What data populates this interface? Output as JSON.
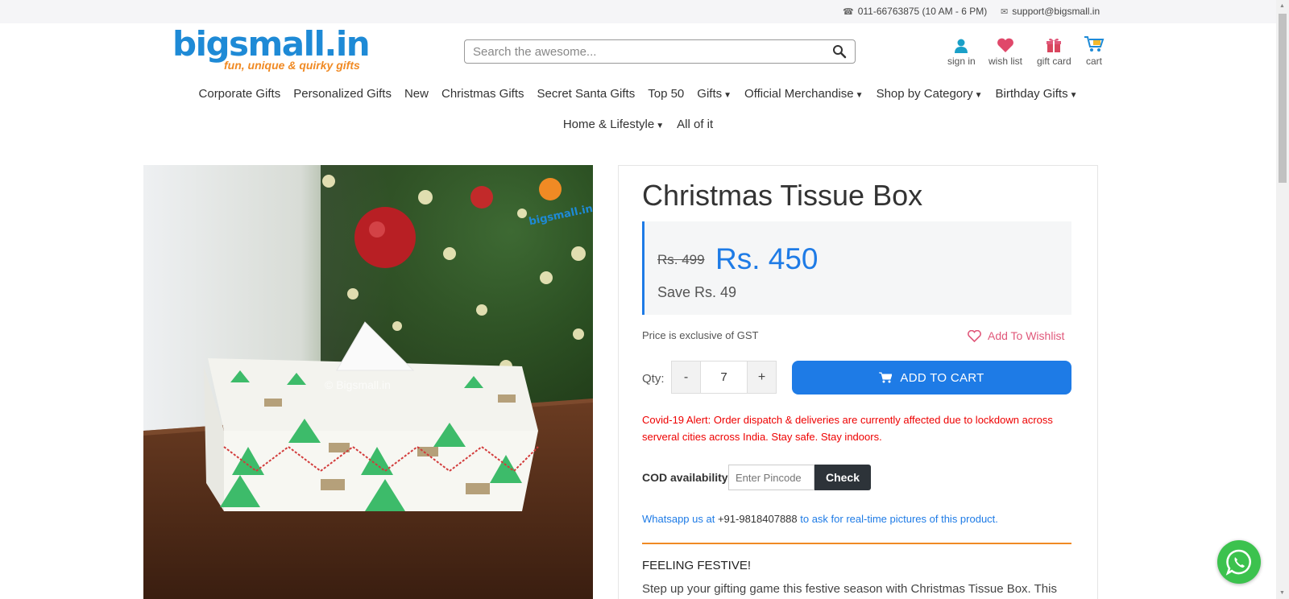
{
  "topbar": {
    "phone": "011-66763875 (10 AM - 6 PM)",
    "email": "support@bigsmall.in"
  },
  "logo": {
    "text": "bigsmall.in",
    "tagline": "fun, unique & quirky gifts"
  },
  "search": {
    "placeholder": "Search the awesome..."
  },
  "header_icons": {
    "signin": "sign in",
    "wishlist": "wish list",
    "giftcard": "gift card",
    "cart": "cart"
  },
  "nav": {
    "row1": [
      "Corporate Gifts",
      "Personalized Gifts",
      "New",
      "Christmas Gifts",
      "Secret Santa Gifts",
      "Top 50",
      "Gifts",
      "Official Merchandise",
      "Shop by Category",
      "Birthday Gifts"
    ],
    "row2": [
      "Home & Lifestyle",
      "All of it"
    ]
  },
  "product": {
    "title": "Christmas Tissue Box",
    "old_price": "Rs. 499",
    "price": "Rs. 450",
    "save": "Save Rs. 49",
    "gst_note": "Price is exclusive of GST",
    "wishlist_label": "Add To Wishlist",
    "qty_label": "Qty:",
    "qty_minus": "-",
    "qty_value": "7",
    "qty_plus": "+",
    "add_to_cart": "ADD TO CART",
    "covid_alert": "Covid-19 Alert: Order dispatch & deliveries are currently affected due to lockdown across serveral cities across India. Stay safe. Stay indoors.",
    "cod_label": "COD availability",
    "pincode_placeholder": "Enter Pincode",
    "check_label": "Check",
    "whatsapp_pre": "Whatsapp us at ",
    "whatsapp_number": "+91-9818407888",
    "whatsapp_post": " to ask for real-time pictures of this product.",
    "section_heading": "FEELING FESTIVE!",
    "description": "Step up your gifting game this festive season with Christmas Tissue Box. This"
  },
  "image": {
    "watermark": "© Bigsmall.in",
    "corner_logo": "bigsmall.in"
  },
  "colors": {
    "accent": "#1e7be6",
    "brand_orange": "#f08a24",
    "alert": "#ee0000",
    "wishlist_pink": "#e0587a"
  }
}
